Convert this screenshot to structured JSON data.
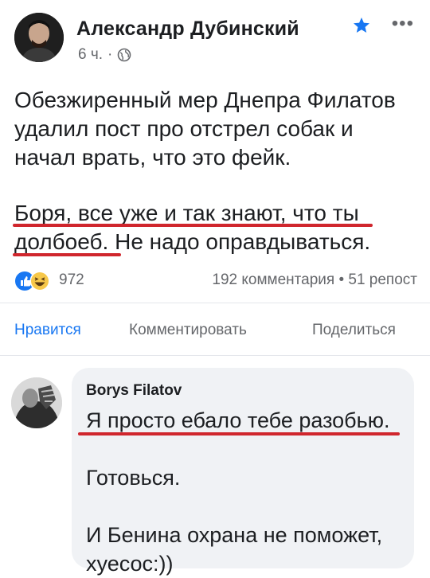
{
  "post": {
    "author": "Александр Дубинский",
    "time": "6 ч.",
    "dot": "·",
    "text_p1_lines": [
      "Обезжиренный мер Днепра Филатов",
      "удалил пост про отстрел собак и",
      "начал врать, что это фейк."
    ],
    "text_p2_lines": [
      "Боря, все уже и так знают, что ты",
      "долбоеб. Не надо оправдываться."
    ],
    "reactions_count": "972",
    "stats": "192 комментария • 51 репост"
  },
  "actions": {
    "like": "Нравится",
    "comment": "Комментировать",
    "share": "Поделиться"
  },
  "comment": {
    "author": "Borys Filatov",
    "lines": [
      "Я просто ебало тебе разобью.",
      "Готовься.",
      "И Бенина охрана не поможет,",
      "хуесос:))"
    ]
  },
  "icons": {
    "star": "star-icon",
    "more": "more-icon",
    "globe": "globe-icon",
    "like_reaction": "like-reaction-icon",
    "haha_reaction": "haha-reaction-icon"
  },
  "colors": {
    "accent": "#1877f2",
    "underline": "#d0262d",
    "secondary_text": "#65676b",
    "bubble": "#f0f2f5"
  }
}
